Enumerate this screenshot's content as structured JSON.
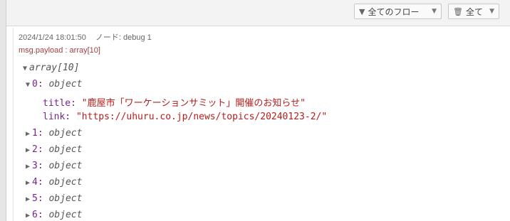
{
  "toolbar": {
    "flow_filter_label": "全てのフロー",
    "clear_label": "全て"
  },
  "message": {
    "timestamp": "2024/1/24 18:01:50",
    "node_label": "ノード: debug 1",
    "topic": "msg.payload : array[10]",
    "root_label": "array[10]",
    "expanded_key": "0:",
    "expanded_type": "object",
    "title_key": "title:",
    "title_open": "\"",
    "title_value": "鹿屋市「ワーケーションサミット」開催のお知らせ",
    "title_close": "\"",
    "link_key": "link:",
    "link_value": "\"https://uhuru.co.jp/news/topics/20240123-2/\"",
    "items": [
      {
        "key": "1:",
        "type": "object"
      },
      {
        "key": "2:",
        "type": "object"
      },
      {
        "key": "3:",
        "type": "object"
      },
      {
        "key": "4:",
        "type": "object"
      },
      {
        "key": "5:",
        "type": "object"
      },
      {
        "key": "6:",
        "type": "object"
      }
    ]
  }
}
